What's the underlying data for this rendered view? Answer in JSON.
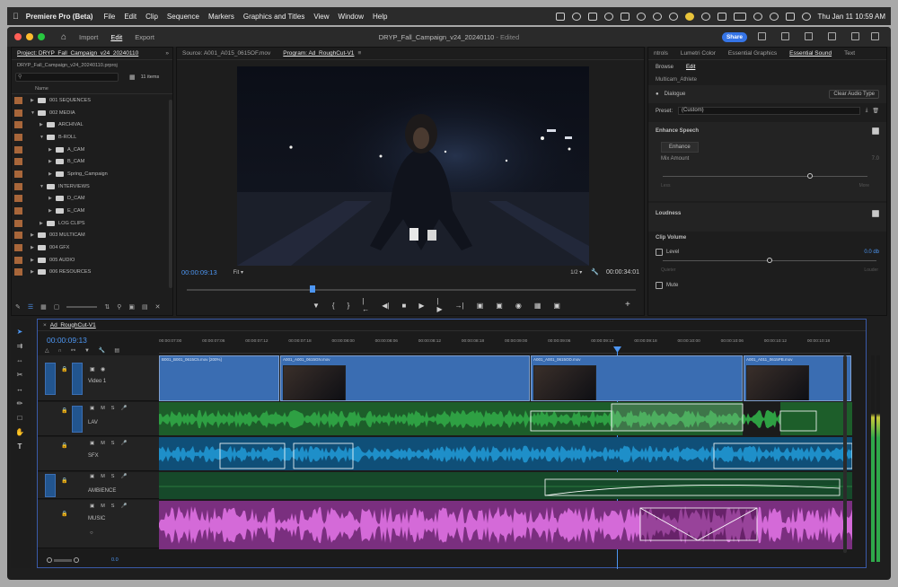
{
  "menubar": {
    "app_name": "Premiere Pro (Beta)",
    "menus": [
      "File",
      "Edit",
      "Clip",
      "Sequence",
      "Markers",
      "Graphics and Titles",
      "View",
      "Window",
      "Help"
    ],
    "clock": "Thu Jan 11  10:59 AM"
  },
  "titlebar": {
    "workspaces": [
      "Import",
      "Edit",
      "Export"
    ],
    "active_workspace": "Edit",
    "document_title": "DRYP_Fall_Campaign_v24_20240110",
    "edited_status": " - Edited",
    "share_label": "Share"
  },
  "project": {
    "tab": "Project: DRYP_Fall_Campaign_v24_20240110",
    "file": "DRYP_Fall_Campaign_v24_20240110.prproj",
    "item_count": "11 items",
    "column_name": "Name",
    "tree": [
      {
        "label": "001 SEQUENCES",
        "indent": 1,
        "open": false
      },
      {
        "label": "002 MEDIA",
        "indent": 1,
        "open": true
      },
      {
        "label": "ARCHIVAL",
        "indent": 2,
        "open": false
      },
      {
        "label": "B-ROLL",
        "indent": 2,
        "open": true
      },
      {
        "label": "A_CAM",
        "indent": 3,
        "open": false
      },
      {
        "label": "B_CAM",
        "indent": 3,
        "open": false
      },
      {
        "label": "Spring_Campaign",
        "indent": 3,
        "open": false
      },
      {
        "label": "INTERVIEWS",
        "indent": 2,
        "open": true
      },
      {
        "label": "D_CAM",
        "indent": 3,
        "open": false
      },
      {
        "label": "E_CAM",
        "indent": 3,
        "open": false
      },
      {
        "label": "LOG CLIPS",
        "indent": 2,
        "open": false
      },
      {
        "label": "003 MULTICAM",
        "indent": 1,
        "open": false
      },
      {
        "label": "004 GFX",
        "indent": 1,
        "open": false
      },
      {
        "label": "005 AUDIO",
        "indent": 1,
        "open": false
      },
      {
        "label": "006 RESOURCES",
        "indent": 1,
        "open": false
      }
    ]
  },
  "monitor": {
    "source_tab": "Source: A001_A015_0615OF.mov",
    "program_tab": "Program: Ad_RoughCut-V1",
    "timecode_in": "00:00:09:13",
    "fit": "Fit",
    "resolution": "1/2",
    "duration": "00:00:34:01",
    "playhead_fraction": 0.28
  },
  "sound": {
    "tabs": [
      "ntrols",
      "Lumetri Color",
      "Essential Graphics",
      "Essential Sound",
      "Text"
    ],
    "active_tab": "Essential Sound",
    "subtabs": [
      "Browse",
      "Edit"
    ],
    "active_subtab": "Edit",
    "clip_name": "Multicam_Athlete",
    "type": "Dialogue",
    "clear_button": "Clear Audio Type",
    "preset_label": "Preset:",
    "preset_value": "(Custom)",
    "enhance_title": "Enhance Speech",
    "enhance_button": "Enhance",
    "mix_amount": "Mix Amount",
    "mix_value": "7.0",
    "mix_fraction": 0.72,
    "low": "Less",
    "high": "More",
    "loudness": "Loudness",
    "clip_volume": "Clip Volume",
    "level": "Level",
    "level_value": "0.0 db",
    "level_fraction": 0.5,
    "quieter": "Quieter",
    "louder": "Louder",
    "mute": "Mute"
  },
  "timeline": {
    "sequence_tab": "Ad_RoughCut-V1",
    "timecode": "00:00:09:13",
    "ruler": [
      "00:00:07:00",
      "00:00:07:06",
      "00:00:07:12",
      "00:00:07:18",
      "00:00:08:00",
      "00:00:08:06",
      "00:00:08:12",
      "00:00:08:18",
      "00:00:09:00",
      "00:00:09:06",
      "00:00:09:12",
      "00:00:09:18",
      "00:00:10:00",
      "00:00:10:06",
      "00:00:10:12",
      "00:00:10:18"
    ],
    "tracks": {
      "video1": "Video 1",
      "lav": "LAV",
      "sfx": "SFX",
      "ambience": "AMBIENCE",
      "music": "MUSIC"
    },
    "clips": {
      "v1": "B001_B001_0615C5.mov [200%]",
      "v2": "A001_A001_0615GN.mov",
      "v3": "A001_A001_0615OD.mov",
      "v4": "A001_A011_0615PB.mov"
    },
    "zoom_value": "0.0"
  },
  "colors": {
    "accent": "#3574e6",
    "lav_audio": "#2ea043",
    "sfx_audio": "#1e8fc9",
    "music_audio": "#d46ad8",
    "ambience_audio": "#1f7a32",
    "timecode": "#4d96f2"
  }
}
